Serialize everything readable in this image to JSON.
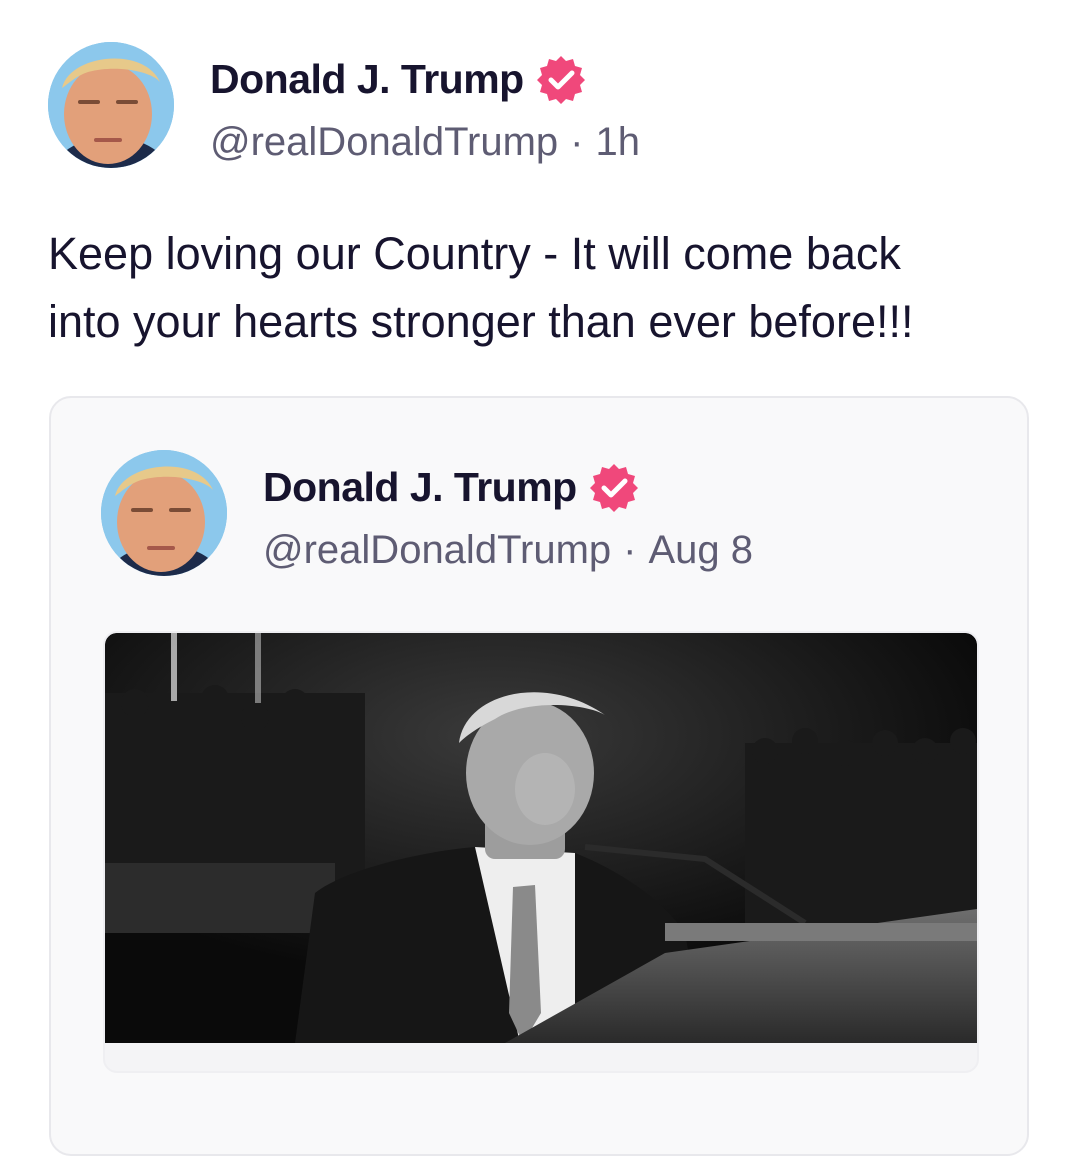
{
  "post": {
    "author": {
      "display_name": "Donald J. Trump",
      "handle": "@realDonaldTrump",
      "separator": "·",
      "time": "1h",
      "verified_icon": "verified-badge-icon",
      "avatar_icon": "profile-photo"
    },
    "text": "Keep loving our Country - It will come back\ninto your hearts stronger than ever before!!!"
  },
  "quoted_post": {
    "author": {
      "display_name": "Donald J. Trump",
      "handle": "@realDonaldTrump",
      "separator": "·",
      "time": "Aug 8",
      "verified_icon": "verified-badge-icon",
      "avatar_icon": "profile-photo"
    },
    "media": {
      "type": "photo",
      "description_icon": "speaker-at-podium-photo"
    }
  },
  "colors": {
    "text_primary": "#17142e",
    "text_secondary": "#5e5c73",
    "verified_badge": "#f0487b",
    "card_border": "#e8e8ec",
    "card_background": "#f9f9fa"
  }
}
